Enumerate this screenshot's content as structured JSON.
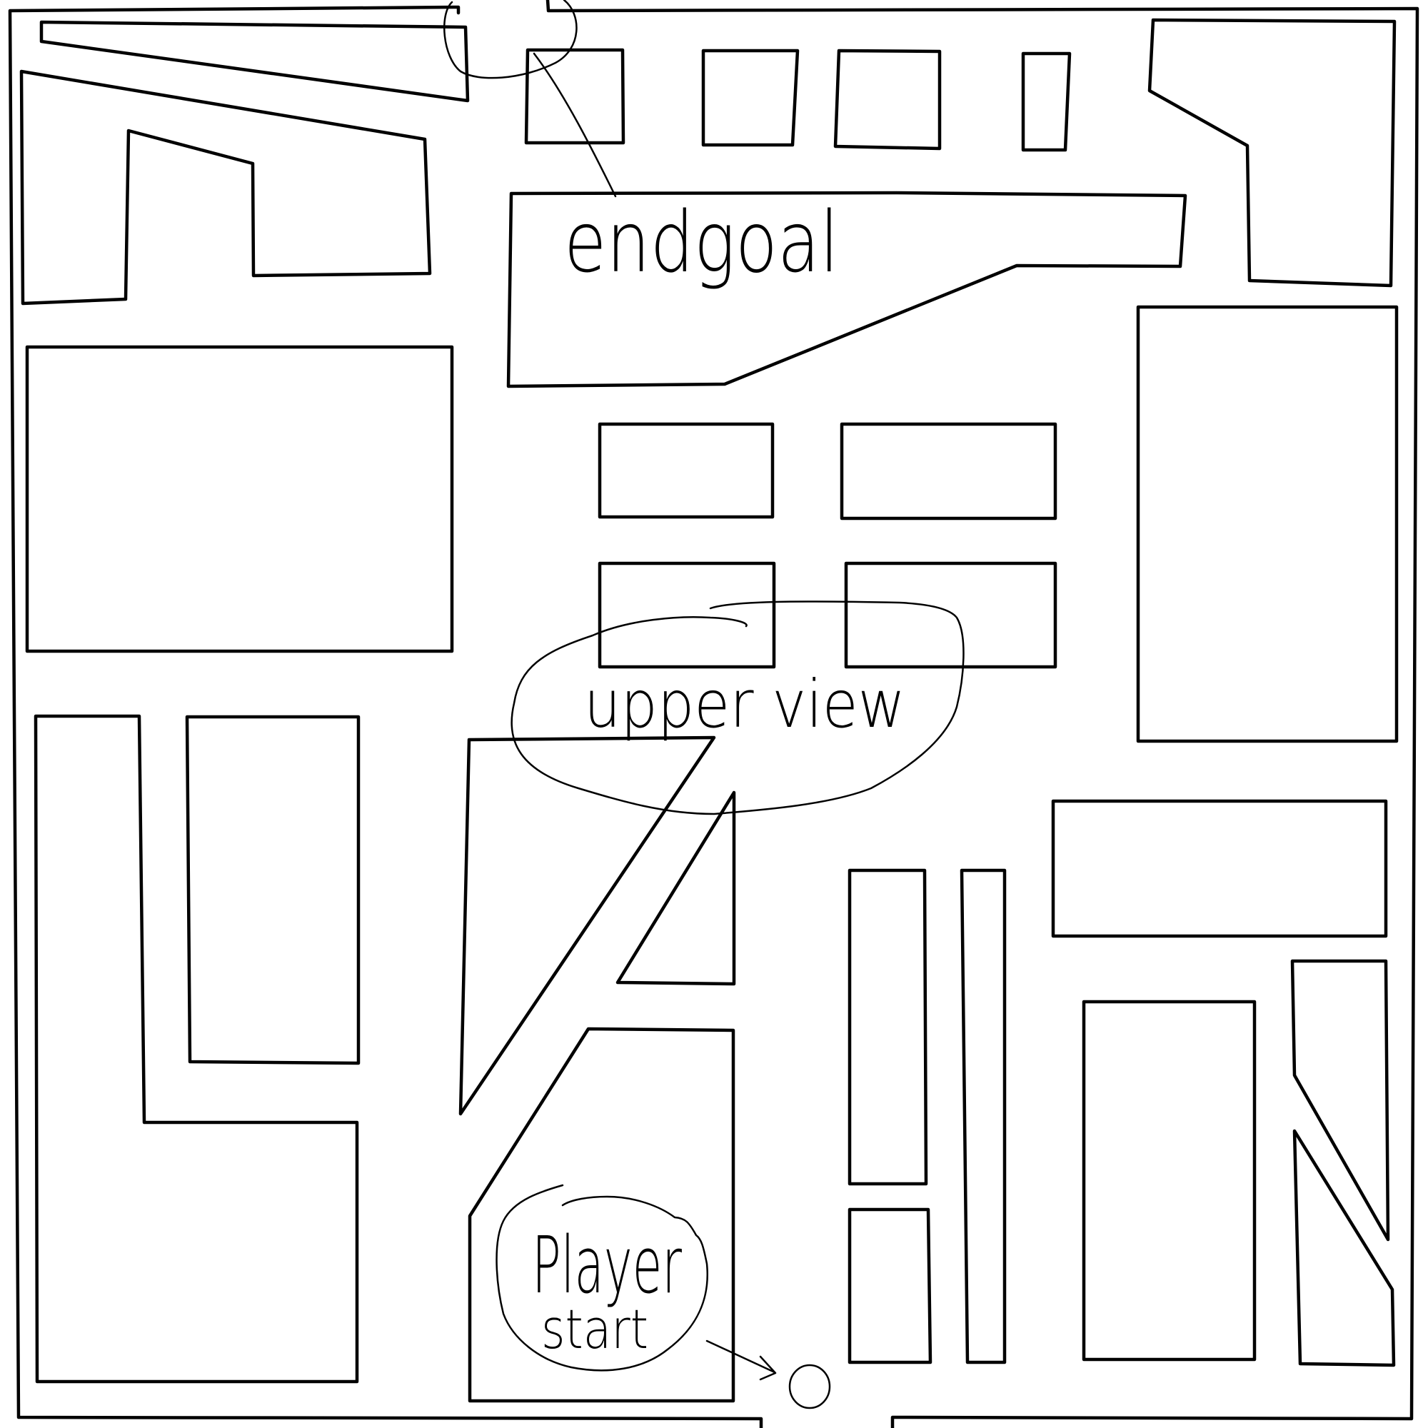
{
  "map": {
    "labels": {
      "end_goal": "endgoal",
      "upper_view": "upper view",
      "player": "Player",
      "start": "start"
    }
  },
  "colors": {
    "ink": "#000000",
    "paper": "#ffffff"
  }
}
